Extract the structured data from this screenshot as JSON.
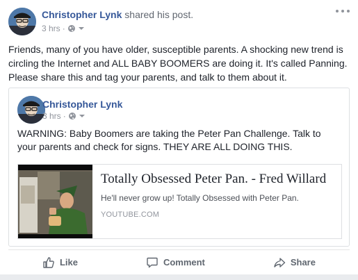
{
  "post": {
    "author": "Christopher Lynk",
    "action": "shared his post.",
    "time": "3 hrs",
    "privacy_icon": "globe-icon",
    "text": "Friends, many of you have older, susceptible parents. A shocking new trend is circling the Internet and ALL BABY BOOMERS are doing it. It's called Panning. Please share this and tag your parents, and talk to them about it."
  },
  "shared_post": {
    "author": "Christopher Lynk",
    "time": "3 hrs",
    "text": "WARNING: Baby Boomers are taking the Peter Pan Challenge. Talk to your parents and check for signs. THEY ARE ALL DOING THIS.",
    "link": {
      "title": "Totally Obsessed Peter Pan. - Fred Willard",
      "description": "He'll never grow up! Totally Obsessed with Peter Pan.",
      "domain": "YOUTUBE.COM"
    }
  },
  "actions": {
    "like": "Like",
    "comment": "Comment",
    "share": "Share"
  },
  "colors": {
    "author_link": "#365899",
    "meta_gray": "#90949c",
    "border": "#dddfe2"
  }
}
